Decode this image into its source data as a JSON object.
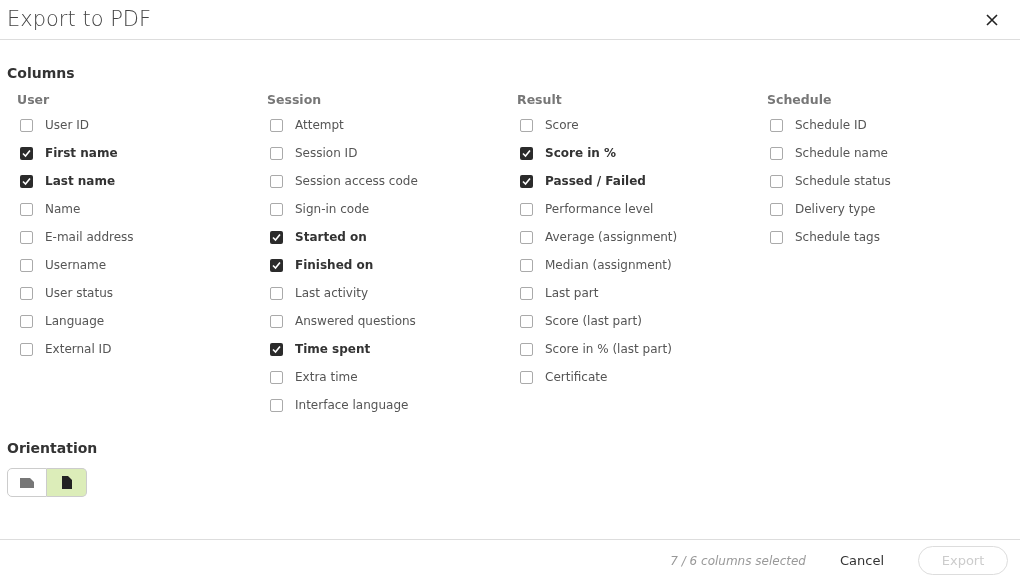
{
  "window": {
    "title": "Export to PDF"
  },
  "columns": {
    "heading": "Columns",
    "groups": [
      {
        "header": "User",
        "items": [
          {
            "label": "User ID",
            "checked": false
          },
          {
            "label": "First name",
            "checked": true
          },
          {
            "label": "Last name",
            "checked": true
          },
          {
            "label": "Name",
            "checked": false
          },
          {
            "label": "E-mail address",
            "checked": false
          },
          {
            "label": "Username",
            "checked": false
          },
          {
            "label": "User status",
            "checked": false
          },
          {
            "label": "Language",
            "checked": false
          },
          {
            "label": "External ID",
            "checked": false
          }
        ]
      },
      {
        "header": "Session",
        "items": [
          {
            "label": "Attempt",
            "checked": false
          },
          {
            "label": "Session ID",
            "checked": false
          },
          {
            "label": "Session access code",
            "checked": false
          },
          {
            "label": "Sign-in code",
            "checked": false
          },
          {
            "label": "Started on",
            "checked": true
          },
          {
            "label": "Finished on",
            "checked": true
          },
          {
            "label": "Last activity",
            "checked": false
          },
          {
            "label": "Answered questions",
            "checked": false
          },
          {
            "label": "Time spent",
            "checked": true
          },
          {
            "label": "Extra time",
            "checked": false
          },
          {
            "label": "Interface language",
            "checked": false
          }
        ]
      },
      {
        "header": "Result",
        "items": [
          {
            "label": "Score",
            "checked": false
          },
          {
            "label": "Score in %",
            "checked": true
          },
          {
            "label": "Passed / Failed",
            "checked": true
          },
          {
            "label": "Performance level",
            "checked": false
          },
          {
            "label": "Average (assignment)",
            "checked": false
          },
          {
            "label": "Median (assignment)",
            "checked": false
          },
          {
            "label": "Last part",
            "checked": false
          },
          {
            "label": "Score (last part)",
            "checked": false
          },
          {
            "label": "Score in % (last part)",
            "checked": false
          },
          {
            "label": "Certificate",
            "checked": false
          }
        ]
      },
      {
        "header": "Schedule",
        "items": [
          {
            "label": "Schedule ID",
            "checked": false
          },
          {
            "label": "Schedule name",
            "checked": false
          },
          {
            "label": "Schedule status",
            "checked": false
          },
          {
            "label": "Delivery type",
            "checked": false
          },
          {
            "label": "Schedule tags",
            "checked": false
          }
        ]
      }
    ]
  },
  "orientation": {
    "heading": "Orientation",
    "options": [
      {
        "kind": "landscape",
        "selected": false
      },
      {
        "kind": "portrait",
        "selected": true
      }
    ]
  },
  "footer": {
    "status": "7 / 6 columns selected",
    "cancel": "Cancel",
    "export": {
      "label": "Export",
      "disabled": true
    }
  }
}
